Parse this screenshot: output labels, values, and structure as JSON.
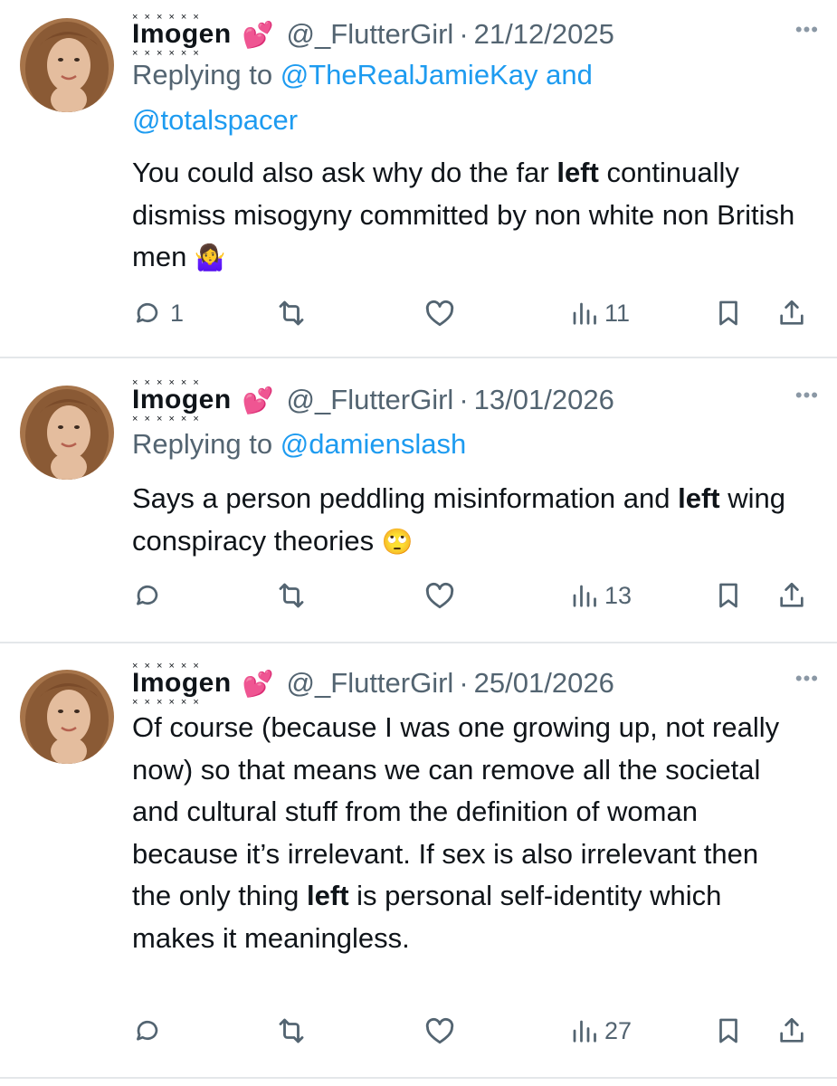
{
  "tweets": [
    {
      "name": "Imogen",
      "name_emoji": "💕",
      "handle": "@_FlutterGirl",
      "separator": "·",
      "date": "21/12/2025",
      "more_icon": "more-icon",
      "replying_prefix": "Replying to",
      "replying_mention_1": "@TheRealJamieKay",
      "replying_and": "and",
      "replying_mention_2": "@totalspacer",
      "body_part_1": "You could also ask why do the far ",
      "body_bold": "left",
      "body_part_2": " continually dismiss misogyny committed by non white non British men ",
      "body_emoji": "🤷‍♀️",
      "reply_count": "1",
      "view_count": "11"
    },
    {
      "name": "Imogen",
      "name_emoji": "💕",
      "handle": "@_FlutterGirl",
      "separator": "·",
      "date": "13/01/2026",
      "more_icon": "more-icon",
      "replying_prefix": "Replying to",
      "replying_mention_1": "@damienslash",
      "body_part_1": "Says a person peddling misinformation and ",
      "body_bold": "left",
      "body_part_2": " wing conspiracy theories ",
      "body_emoji": "🙄",
      "reply_count": "",
      "view_count": "13"
    },
    {
      "name": "Imogen",
      "name_emoji": "💕",
      "handle": "@_FlutterGirl",
      "separator": "·",
      "date": "25/01/2026",
      "more_icon": "more-icon",
      "body_part_1": "Of course (because I was one growing up, not really now) so that means we can remove all the societal and cultural stuff from the definition of woman because it’s irrelevant. If sex is also irrelevant then the only thing ",
      "body_bold": "left",
      "body_part_2": " is personal self-identity which makes it meaningless.",
      "reply_count": "",
      "view_count": "27"
    }
  ],
  "icons": [
    "reply-icon",
    "retweet-icon",
    "like-icon",
    "views-icon",
    "bookmark-icon",
    "share-icon"
  ],
  "colors": {
    "text": "#0f1419",
    "secondary": "#536471",
    "link": "#1d9bf0",
    "divider": "#e4e7ea",
    "heart": "#e0457b"
  }
}
